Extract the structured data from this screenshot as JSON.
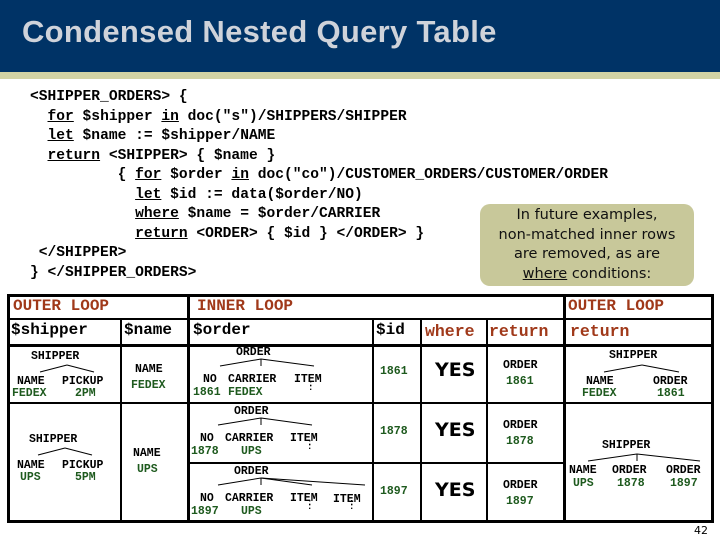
{
  "title": "Condensed Nested Query Table",
  "code": {
    "lines": [
      {
        "parts": [
          {
            "t": "<SHIPPER_ORDERS> {"
          }
        ]
      },
      {
        "parts": [
          {
            "t": "  "
          },
          {
            "t": "for",
            "u": true
          },
          {
            "t": " $shipper "
          },
          {
            "t": "in",
            "u": true
          },
          {
            "t": " doc(\"s\")/SHIPPERS/SHIPPER"
          }
        ]
      },
      {
        "parts": [
          {
            "t": "  "
          },
          {
            "t": "let",
            "u": true
          },
          {
            "t": " $name := $shipper/NAME"
          }
        ]
      },
      {
        "parts": [
          {
            "t": "  "
          },
          {
            "t": "return",
            "u": true
          },
          {
            "t": " <SHIPPER> { $name }"
          }
        ]
      },
      {
        "parts": [
          {
            "t": "          { "
          },
          {
            "t": "for",
            "u": true
          },
          {
            "t": " $order "
          },
          {
            "t": "in",
            "u": true
          },
          {
            "t": " doc(\"co\")/CUSTOMER_ORDERS/CUSTOMER/ORDER"
          }
        ]
      },
      {
        "parts": [
          {
            "t": "            "
          },
          {
            "t": "let",
            "u": true
          },
          {
            "t": " $id := data($order/NO)"
          }
        ]
      },
      {
        "parts": [
          {
            "t": "            "
          },
          {
            "t": "where",
            "u": true
          },
          {
            "t": " $name = $order/CARRIER"
          }
        ]
      },
      {
        "parts": [
          {
            "t": "            "
          },
          {
            "t": "return",
            "u": true
          },
          {
            "t": " <ORDER> { $id } </ORDER> }"
          }
        ]
      },
      {
        "parts": [
          {
            "t": " </SHIPPER>"
          }
        ]
      },
      {
        "parts": [
          {
            "t": "} </SHIPPER_ORDERS>"
          }
        ]
      }
    ]
  },
  "callout": {
    "line1": "In future examples,",
    "line2": "non-matched inner rows",
    "line3": "are removed, as are",
    "line4_underlined": "where",
    "line4_rest": " conditions:"
  },
  "table": {
    "group_headers": {
      "outer_loop_left": "OUTER LOOP",
      "inner_loop": "INNER LOOP",
      "outer_loop_right": "OUTER LOOP"
    },
    "columns": [
      "$shipper",
      "$name",
      "$order",
      "$id",
      "where",
      "return",
      "return"
    ],
    "rows": [
      {
        "shipper": {
          "root": "SHIPPER",
          "fields": [
            "NAME",
            "PICKUP"
          ],
          "values": [
            "FEDEX",
            "2PM"
          ]
        },
        "name": {
          "label": "NAME",
          "value": "FEDEX"
        },
        "orders": [
          {
            "root": "ORDER",
            "fields": [
              "NO",
              "CARRIER",
              "ITEM"
            ],
            "values": [
              "1861",
              "FEDEX"
            ]
          }
        ]
      },
      {
        "shipper": {
          "root": "SHIPPER",
          "fields": [
            "NAME",
            "PICKUP"
          ],
          "values": [
            "UPS",
            "5PM"
          ]
        },
        "name": {
          "label": "NAME",
          "value": "UPS"
        },
        "orders": [
          {
            "root": "ORDER",
            "fields": [
              "NO",
              "CARRIER",
              "ITEM"
            ],
            "values": [
              "1878",
              "UPS"
            ]
          },
          {
            "root": "ORDER",
            "fields": [
              "NO",
              "CARRIER",
              "ITEM",
              "ITEM"
            ],
            "values": [
              "1897",
              "UPS"
            ]
          }
        ]
      }
    ],
    "inner_rows": [
      {
        "id": "1861",
        "where": "YES",
        "return_label": "ORDER",
        "return_value": "1861"
      },
      {
        "id": "1878",
        "where": "YES",
        "return_label": "ORDER",
        "return_value": "1878"
      },
      {
        "id": "1897",
        "where": "YES",
        "return_label": "ORDER",
        "return_value": "1897"
      }
    ],
    "outer_return": [
      {
        "root": "SHIPPER",
        "fields": [
          "NAME",
          "ORDER"
        ],
        "values": [
          "FEDEX",
          "1861"
        ]
      },
      {
        "root": "SHIPPER",
        "fields": [
          "NAME",
          "ORDER",
          "ORDER"
        ],
        "values": [
          "UPS",
          "1878",
          "1897"
        ]
      }
    ]
  },
  "page_number": "42",
  "colors": {
    "title_bar": "#003366",
    "title_text": "#cfd3da",
    "stripe": "#d2d3a5",
    "header_red": "#a0391a",
    "value_green": "#1e5a1e",
    "callout_bg": "#c8c89a"
  }
}
